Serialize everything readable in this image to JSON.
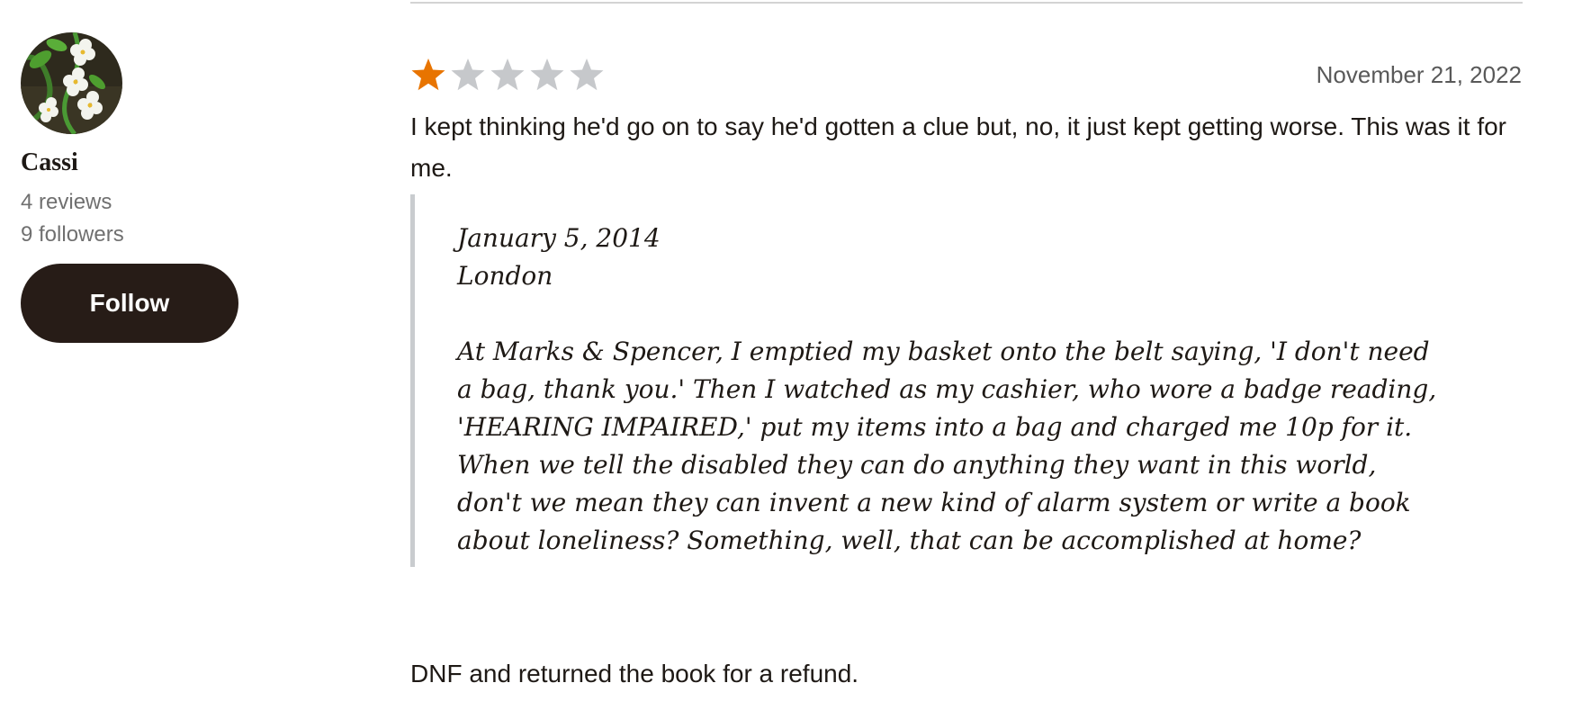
{
  "reviewer": {
    "name": "Cassi",
    "reviews": "4 reviews",
    "followers": "9 followers",
    "follow_label": "Follow",
    "avatar_icon": "flower-photo-avatar"
  },
  "review": {
    "rating": 1,
    "rating_max": 5,
    "date": "November 21, 2022",
    "intro": "I kept thinking he'd go on to say he'd gotten a clue but, no, it just kept getting worse. This was it for me.",
    "quote": {
      "date_line": "January 5, 2014",
      "place_line": "London",
      "passage": "At Marks & Spencer, I emptied my basket onto the belt saying, 'I don't need a bag, thank you.' Then I watched as my cashier, who wore a badge reading, 'HEARING IMPAIRED,' put my items into a bag and charged me 10p for it. When we tell the disabled they can do anything they want in this world, don't we mean they can invent a new kind of alarm system or write a book about loneliness? Something, well, that can be accomplished at home?"
    },
    "closing": "DNF and returned the book for a refund."
  },
  "colors": {
    "star_filled": "#e87400",
    "star_empty": "#c6c8cb",
    "follow_button_bg": "#271c17",
    "quote_border": "#c9cccf"
  }
}
